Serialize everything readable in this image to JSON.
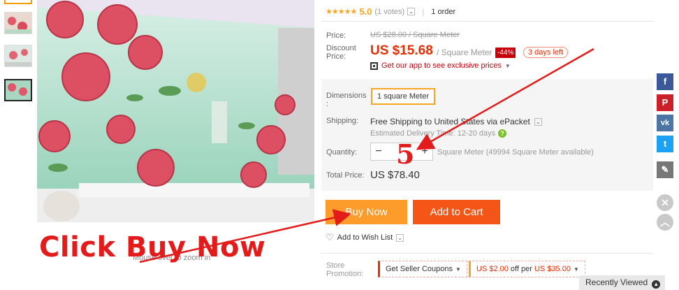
{
  "gallery": {
    "thumbnails": [
      "thumb-1",
      "thumb-2",
      "thumb-3",
      "thumb-4"
    ],
    "zoom_hint": "Mouse over to zoom in"
  },
  "product": {
    "rating_score": "5.0",
    "rating_votes": "(1 votes)",
    "orders": "1 order",
    "price_label": "Price:",
    "original_price": "US $28.00 / Square Meter",
    "discount_label_1": "Discount",
    "discount_label_2": "Price:",
    "sale_price": "US $15.68",
    "unit": "/ Square Meter",
    "discount_pct": "-44%",
    "days_left": "3 days left",
    "app_promo": "Get our app to see exclusive prices",
    "dimensions_label_1": "Dimensions",
    "dimensions_label_2": ":",
    "dimension_value": "1 square Meter",
    "shipping_label": "Shipping:",
    "shipping_text": "Free Shipping to United States via ePacket",
    "delivery_text": "Estimated Delivery Time: 12-20 days",
    "quantity_label": "Quantity:",
    "qty_minus": "−",
    "qty_plus": "+",
    "availability": "Square Meter (49994 Square Meter available)",
    "total_label": "Total Price:",
    "total_price": "US $78.40",
    "buy_now": "Buy Now",
    "add_to_cart": "Add to Cart",
    "wish_list": "Add to Wish List",
    "store_promo_1": "Store",
    "store_promo_2": "Promotion:",
    "coupon_1": "Get Seller Coupons",
    "coupon_2_a": "US $2.00",
    "coupon_2_b": " off per ",
    "coupon_2_c": "US $35.00"
  },
  "annotation": {
    "click_text": "Click Buy Now",
    "quantity_mark": "5",
    "color": "#e31b1b"
  },
  "social": {
    "facebook": "f",
    "pinterest": "P",
    "vk": "vk",
    "twitter": "t",
    "edit": "✎",
    "close": "✕",
    "up": "︿"
  },
  "footer": {
    "recently_viewed": "Recently Viewed"
  },
  "colors": {
    "buy_now": "#fd9b2b",
    "add_to_cart": "#f55617",
    "sale_price": "#e62e04"
  }
}
